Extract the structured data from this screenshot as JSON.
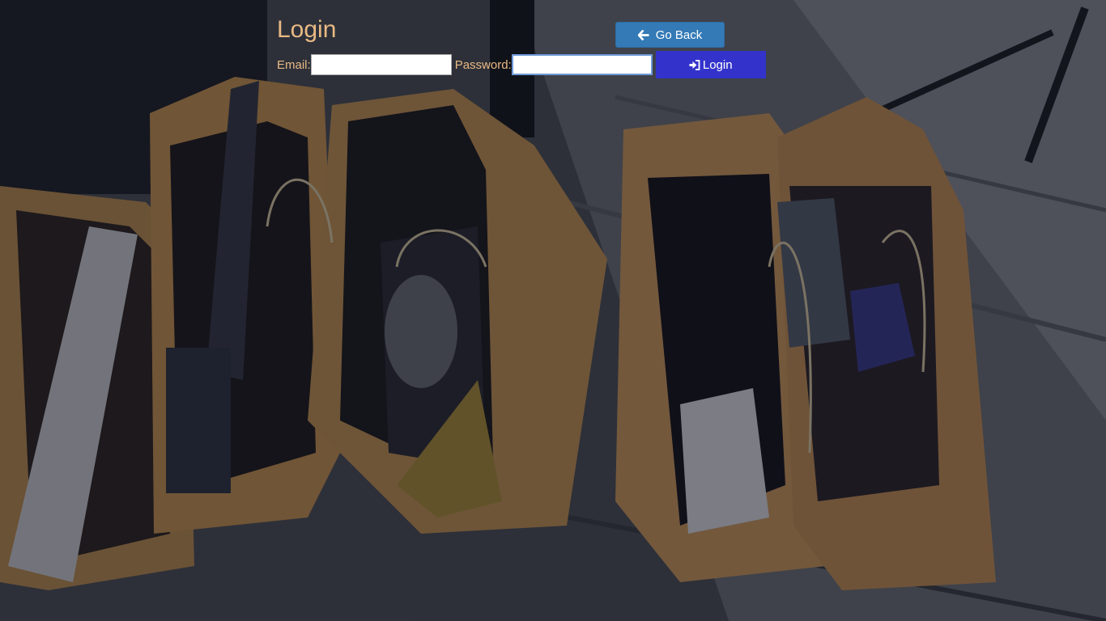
{
  "page": {
    "title": "Login"
  },
  "nav": {
    "go_back_label": "Go Back",
    "go_back_icon": "arrow-left-icon"
  },
  "form": {
    "email_label": "Email:",
    "email_value": "",
    "password_label": "Password:",
    "password_value": "",
    "login_label": "Login",
    "login_icon": "sign-in-icon"
  },
  "colors": {
    "label_text": "#e8b984",
    "go_back_button": "#337ab7",
    "login_button": "#3333cc"
  }
}
